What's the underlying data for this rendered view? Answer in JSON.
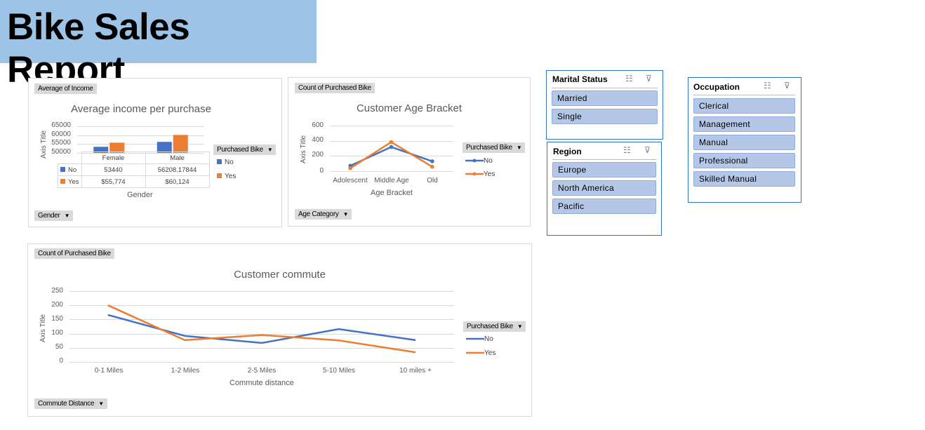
{
  "report_title": "Bike Sales Report",
  "colors": {
    "no": "#4472c4",
    "yes": "#ed7d31",
    "banner": "#9dc3e6"
  },
  "chart_income": {
    "value_button": "Average of Income",
    "axis_button": "Gender",
    "legend_button": "Purchased Bike",
    "legend_no": "No",
    "legend_yes": "Yes",
    "table_no_label": "No",
    "table_yes_label": "Yes",
    "table_no_female": "53440",
    "table_no_male": "56208.17844",
    "table_yes_female": "$55,774",
    "table_yes_male": "$60,124"
  },
  "chart_age": {
    "value_button": "Count of Purchased Bike",
    "axis_button": "Age Category",
    "legend_button": "Purchased Bike",
    "legend_no": "No",
    "legend_yes": "Yes"
  },
  "chart_commute": {
    "value_button": "Count of Purchased Bike",
    "axis_button": "Commute Distance",
    "legend_button": "Purchased Bike",
    "legend_no": "No",
    "legend_yes": "Yes"
  },
  "chart_data": [
    {
      "type": "bar",
      "title": "Average income per purchase",
      "xlabel": "Gender",
      "ylabel": "Axis Title",
      "categories": [
        "Female",
        "Male"
      ],
      "yticks": [
        "65000",
        "60000",
        "55000",
        "50000"
      ],
      "ylim": [
        50000,
        65000
      ],
      "series": [
        {
          "name": "No",
          "values": [
            53440,
            56208.17844
          ]
        },
        {
          "name": "Yes",
          "values": [
            55774,
            60124
          ]
        }
      ]
    },
    {
      "type": "line",
      "title": "Customer Age Bracket",
      "xlabel": "Age Bracket",
      "ylabel": "Axis Title",
      "categories": [
        "Adolescent",
        "Middle Age",
        "Old"
      ],
      "yticks": [
        "600",
        "400",
        "200",
        "0"
      ],
      "ylim": [
        0,
        600
      ],
      "series": [
        {
          "name": "No",
          "values": [
            71,
            318,
            130
          ]
        },
        {
          "name": "Yes",
          "values": [
            39,
            383,
            58
          ]
        }
      ]
    },
    {
      "type": "line",
      "title": "Customer commute",
      "xlabel": "Commute distance",
      "ylabel": "Axis Title",
      "categories": [
        "0-1 Miles",
        "1-2 Miles",
        "2-5 Miles",
        "5-10 Miles",
        "10 miles +"
      ],
      "yticks": [
        "250",
        "200",
        "150",
        "100",
        "50",
        "0"
      ],
      "ylim": [
        0,
        250
      ],
      "series": [
        {
          "name": "No",
          "values": [
            166,
            92,
            67,
            116,
            77
          ]
        },
        {
          "name": "Yes",
          "values": [
            200,
            77,
            95,
            76,
            34
          ]
        }
      ]
    }
  ],
  "slicers": {
    "marital": {
      "title": "Marital Status",
      "items": [
        "Married",
        "Single"
      ]
    },
    "region": {
      "title": "Region",
      "items": [
        "Europe",
        "North America",
        "Pacific"
      ]
    },
    "occupation": {
      "title": "Occupation",
      "items": [
        "Clerical",
        "Management",
        "Manual",
        "Professional",
        "Skilled Manual"
      ]
    }
  }
}
